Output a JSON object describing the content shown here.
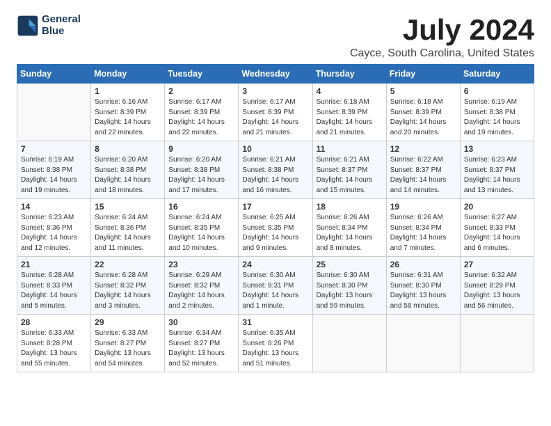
{
  "header": {
    "logo_line1": "General",
    "logo_line2": "Blue",
    "month_title": "July 2024",
    "location": "Cayce, South Carolina, United States"
  },
  "weekdays": [
    "Sunday",
    "Monday",
    "Tuesday",
    "Wednesday",
    "Thursday",
    "Friday",
    "Saturday"
  ],
  "weeks": [
    [
      {
        "day": "",
        "info": ""
      },
      {
        "day": "1",
        "info": "Sunrise: 6:16 AM\nSunset: 8:39 PM\nDaylight: 14 hours\nand 22 minutes."
      },
      {
        "day": "2",
        "info": "Sunrise: 6:17 AM\nSunset: 8:39 PM\nDaylight: 14 hours\nand 22 minutes."
      },
      {
        "day": "3",
        "info": "Sunrise: 6:17 AM\nSunset: 8:39 PM\nDaylight: 14 hours\nand 21 minutes."
      },
      {
        "day": "4",
        "info": "Sunrise: 6:18 AM\nSunset: 8:39 PM\nDaylight: 14 hours\nand 21 minutes."
      },
      {
        "day": "5",
        "info": "Sunrise: 6:18 AM\nSunset: 8:39 PM\nDaylight: 14 hours\nand 20 minutes."
      },
      {
        "day": "6",
        "info": "Sunrise: 6:19 AM\nSunset: 8:38 PM\nDaylight: 14 hours\nand 19 minutes."
      }
    ],
    [
      {
        "day": "7",
        "info": "Sunrise: 6:19 AM\nSunset: 8:38 PM\nDaylight: 14 hours\nand 19 minutes."
      },
      {
        "day": "8",
        "info": "Sunrise: 6:20 AM\nSunset: 8:38 PM\nDaylight: 14 hours\nand 18 minutes."
      },
      {
        "day": "9",
        "info": "Sunrise: 6:20 AM\nSunset: 8:38 PM\nDaylight: 14 hours\nand 17 minutes."
      },
      {
        "day": "10",
        "info": "Sunrise: 6:21 AM\nSunset: 8:38 PM\nDaylight: 14 hours\nand 16 minutes."
      },
      {
        "day": "11",
        "info": "Sunrise: 6:21 AM\nSunset: 8:37 PM\nDaylight: 14 hours\nand 15 minutes."
      },
      {
        "day": "12",
        "info": "Sunrise: 6:22 AM\nSunset: 8:37 PM\nDaylight: 14 hours\nand 14 minutes."
      },
      {
        "day": "13",
        "info": "Sunrise: 6:23 AM\nSunset: 8:37 PM\nDaylight: 14 hours\nand 13 minutes."
      }
    ],
    [
      {
        "day": "14",
        "info": "Sunrise: 6:23 AM\nSunset: 8:36 PM\nDaylight: 14 hours\nand 12 minutes."
      },
      {
        "day": "15",
        "info": "Sunrise: 6:24 AM\nSunset: 8:36 PM\nDaylight: 14 hours\nand 11 minutes."
      },
      {
        "day": "16",
        "info": "Sunrise: 6:24 AM\nSunset: 8:35 PM\nDaylight: 14 hours\nand 10 minutes."
      },
      {
        "day": "17",
        "info": "Sunrise: 6:25 AM\nSunset: 8:35 PM\nDaylight: 14 hours\nand 9 minutes."
      },
      {
        "day": "18",
        "info": "Sunrise: 6:26 AM\nSunset: 8:34 PM\nDaylight: 14 hours\nand 8 minutes."
      },
      {
        "day": "19",
        "info": "Sunrise: 6:26 AM\nSunset: 8:34 PM\nDaylight: 14 hours\nand 7 minutes."
      },
      {
        "day": "20",
        "info": "Sunrise: 6:27 AM\nSunset: 8:33 PM\nDaylight: 14 hours\nand 6 minutes."
      }
    ],
    [
      {
        "day": "21",
        "info": "Sunrise: 6:28 AM\nSunset: 8:33 PM\nDaylight: 14 hours\nand 5 minutes."
      },
      {
        "day": "22",
        "info": "Sunrise: 6:28 AM\nSunset: 8:32 PM\nDaylight: 14 hours\nand 3 minutes."
      },
      {
        "day": "23",
        "info": "Sunrise: 6:29 AM\nSunset: 8:32 PM\nDaylight: 14 hours\nand 2 minutes."
      },
      {
        "day": "24",
        "info": "Sunrise: 6:30 AM\nSunset: 8:31 PM\nDaylight: 14 hours\nand 1 minute."
      },
      {
        "day": "25",
        "info": "Sunrise: 6:30 AM\nSunset: 8:30 PM\nDaylight: 13 hours\nand 59 minutes."
      },
      {
        "day": "26",
        "info": "Sunrise: 6:31 AM\nSunset: 8:30 PM\nDaylight: 13 hours\nand 58 minutes."
      },
      {
        "day": "27",
        "info": "Sunrise: 6:32 AM\nSunset: 8:29 PM\nDaylight: 13 hours\nand 56 minutes."
      }
    ],
    [
      {
        "day": "28",
        "info": "Sunrise: 6:33 AM\nSunset: 8:28 PM\nDaylight: 13 hours\nand 55 minutes."
      },
      {
        "day": "29",
        "info": "Sunrise: 6:33 AM\nSunset: 8:27 PM\nDaylight: 13 hours\nand 54 minutes."
      },
      {
        "day": "30",
        "info": "Sunrise: 6:34 AM\nSunset: 8:27 PM\nDaylight: 13 hours\nand 52 minutes."
      },
      {
        "day": "31",
        "info": "Sunrise: 6:35 AM\nSunset: 8:26 PM\nDaylight: 13 hours\nand 51 minutes."
      },
      {
        "day": "",
        "info": ""
      },
      {
        "day": "",
        "info": ""
      },
      {
        "day": "",
        "info": ""
      }
    ]
  ]
}
